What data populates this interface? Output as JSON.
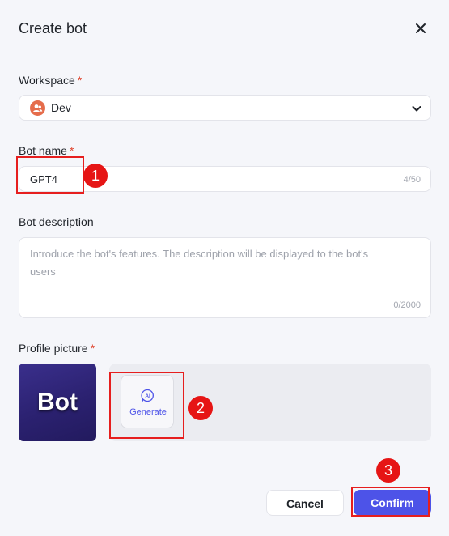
{
  "dialog": {
    "title": "Create bot"
  },
  "workspace": {
    "label": "Workspace",
    "required_mark": "*",
    "selected": "Dev"
  },
  "bot_name": {
    "label": "Bot name",
    "required_mark": "*",
    "value": "GPT4",
    "counter": "4/50"
  },
  "bot_description": {
    "label": "Bot description",
    "placeholder": "Introduce the bot's features. The description will be displayed to the bot's users",
    "counter": "0/2000"
  },
  "profile_picture": {
    "label": "Profile picture",
    "required_mark": "*",
    "image_text": "Bot",
    "generate_label": "Generate",
    "ai_icon_text": "AI"
  },
  "footer": {
    "cancel_label": "Cancel",
    "confirm_label": "Confirm"
  },
  "annotations": {
    "badge_1": "1",
    "badge_2": "2",
    "badge_3": "3"
  },
  "colors": {
    "accent": "#4d53e8",
    "required": "#e0442d",
    "annotation_red": "#e61515",
    "workspace_avatar": "#e56c4b"
  },
  "icons": {
    "close": "close-icon",
    "workspace_avatar": "users-icon",
    "dropdown": "chevron-down-icon",
    "generate": "ai-chat-icon"
  }
}
